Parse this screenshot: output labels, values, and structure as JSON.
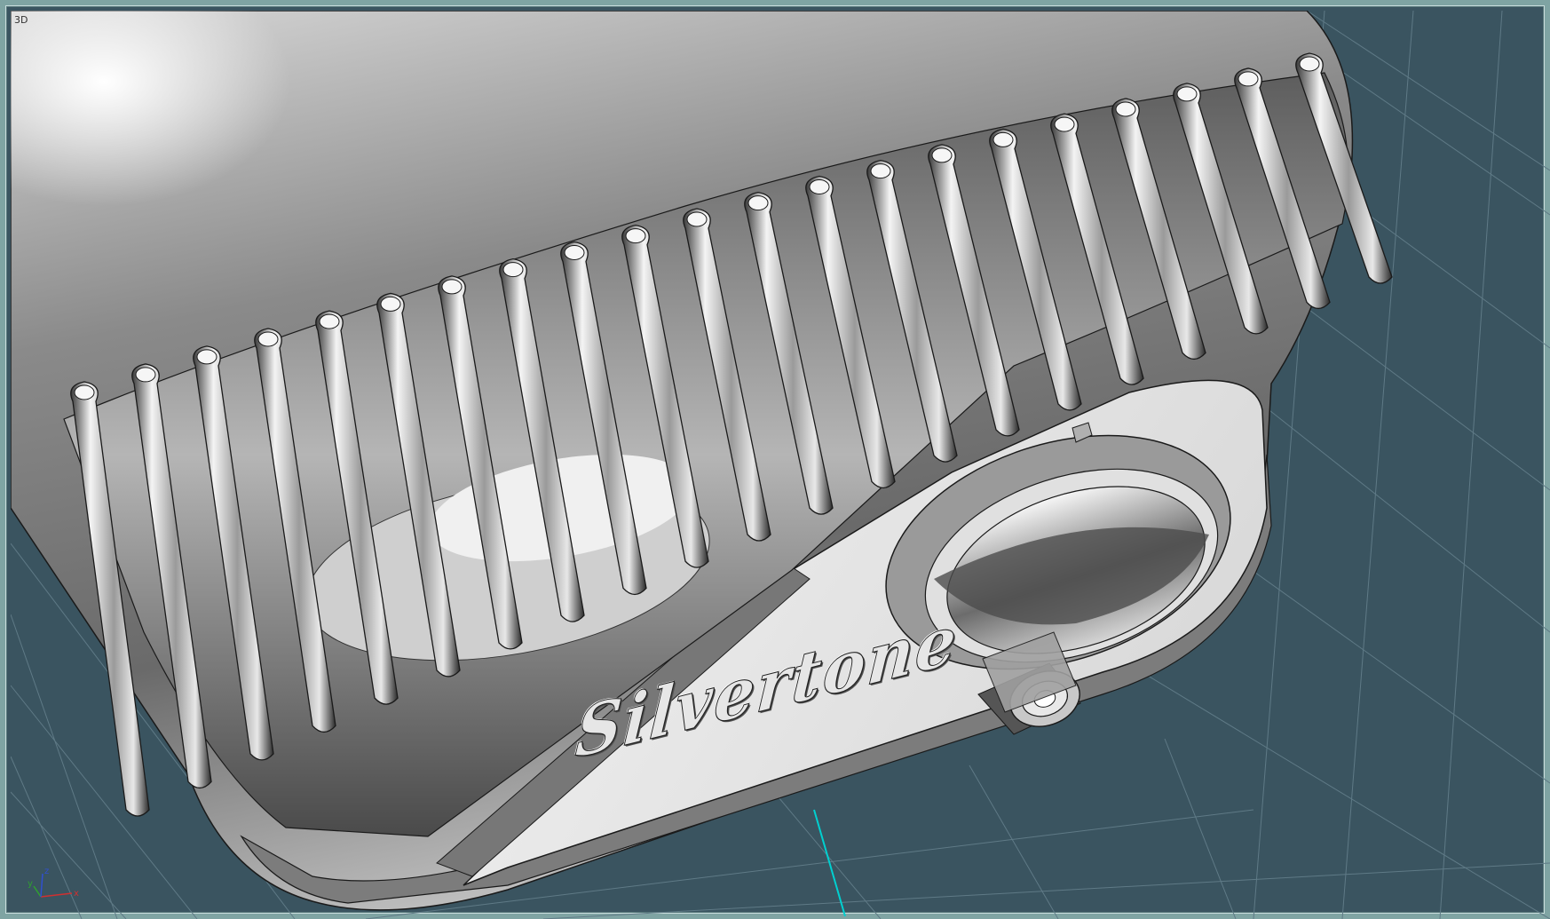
{
  "viewport": {
    "label": "3D",
    "view": "perspective",
    "background_color": "#3a5460",
    "grid_color": "#5f7a86",
    "frame_color": "#7fa4a3"
  },
  "axis_indicator": {
    "x_label": "x",
    "y_label": "y",
    "z_label": "z",
    "x_color": "#d03030",
    "y_color": "#30a030",
    "z_color": "#3050d0"
  },
  "model": {
    "brand_text": "Silvertone",
    "grille_bar_count": 21,
    "body_color": "#9c9c9c",
    "face_color": "#e9e9e9",
    "edge_color": "#1a1a1a",
    "highlight_axis_color": "#00d0d0"
  }
}
